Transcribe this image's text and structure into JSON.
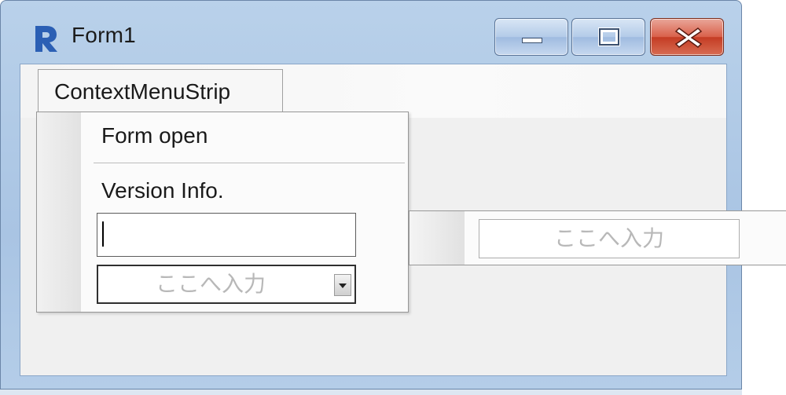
{
  "window": {
    "title": "Form1",
    "icon": "app-r-icon",
    "buttons": {
      "minimize": "minimize-icon",
      "maximize": "maximize-icon",
      "close": "close-icon"
    }
  },
  "menubar": {
    "tab_label": "ContextMenuStrip"
  },
  "dropdown": {
    "item1": "Form open",
    "item2": "Version Info.",
    "textbox_value": "",
    "combo_placeholder": "ここへ入力"
  },
  "submenu": {
    "input_placeholder": "ここへ入力"
  },
  "colors": {
    "frame": "#b9d1ea",
    "close": "#c43c24",
    "icon_blue": "#2b5fb4"
  }
}
